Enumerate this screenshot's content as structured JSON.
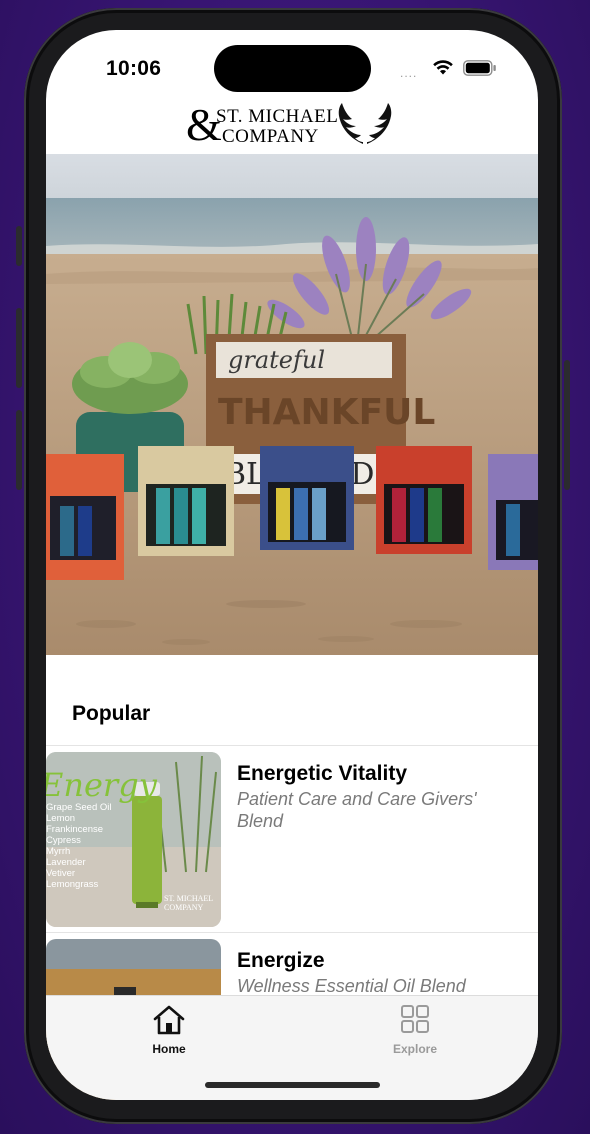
{
  "status_bar": {
    "time": "10:06",
    "signal_dots": "....",
    "wifi_icon": "wifi-icon",
    "battery_icon": "battery-icon"
  },
  "header": {
    "logo": {
      "line1": "ST. MICHAEL",
      "ampersand": "&",
      "line2": "COMPANY",
      "icon": "wings-icon"
    }
  },
  "hero": {
    "description_icon": "hero-photo"
  },
  "popular": {
    "title": "Popular",
    "items": [
      {
        "title": "Energetic Vitality",
        "subtitle": "Patient Care and Care Givers' Blend",
        "thumb_heading": "Energy",
        "thumb_ingredients": [
          "Grape Seed Oil",
          "Lemon",
          "Frankincense",
          "Cypress",
          "Myrrh",
          "Lavender",
          "Vetiver",
          "Lemongrass"
        ],
        "thumb_logo_line1": "ST. MICHAEL",
        "thumb_logo_line2": "COMPANY"
      },
      {
        "title": "Energize",
        "subtitle": "Wellness Essential Oil Blend"
      }
    ]
  },
  "tabbar": {
    "tabs": [
      {
        "label": "Home",
        "icon": "home-icon",
        "active": true
      },
      {
        "label": "Explore",
        "icon": "grid-icon",
        "active": false
      }
    ]
  },
  "colors": {
    "active_tab": "#111111",
    "inactive_tab": "#9a9a9a",
    "subtitle": "#7a7a7a"
  }
}
